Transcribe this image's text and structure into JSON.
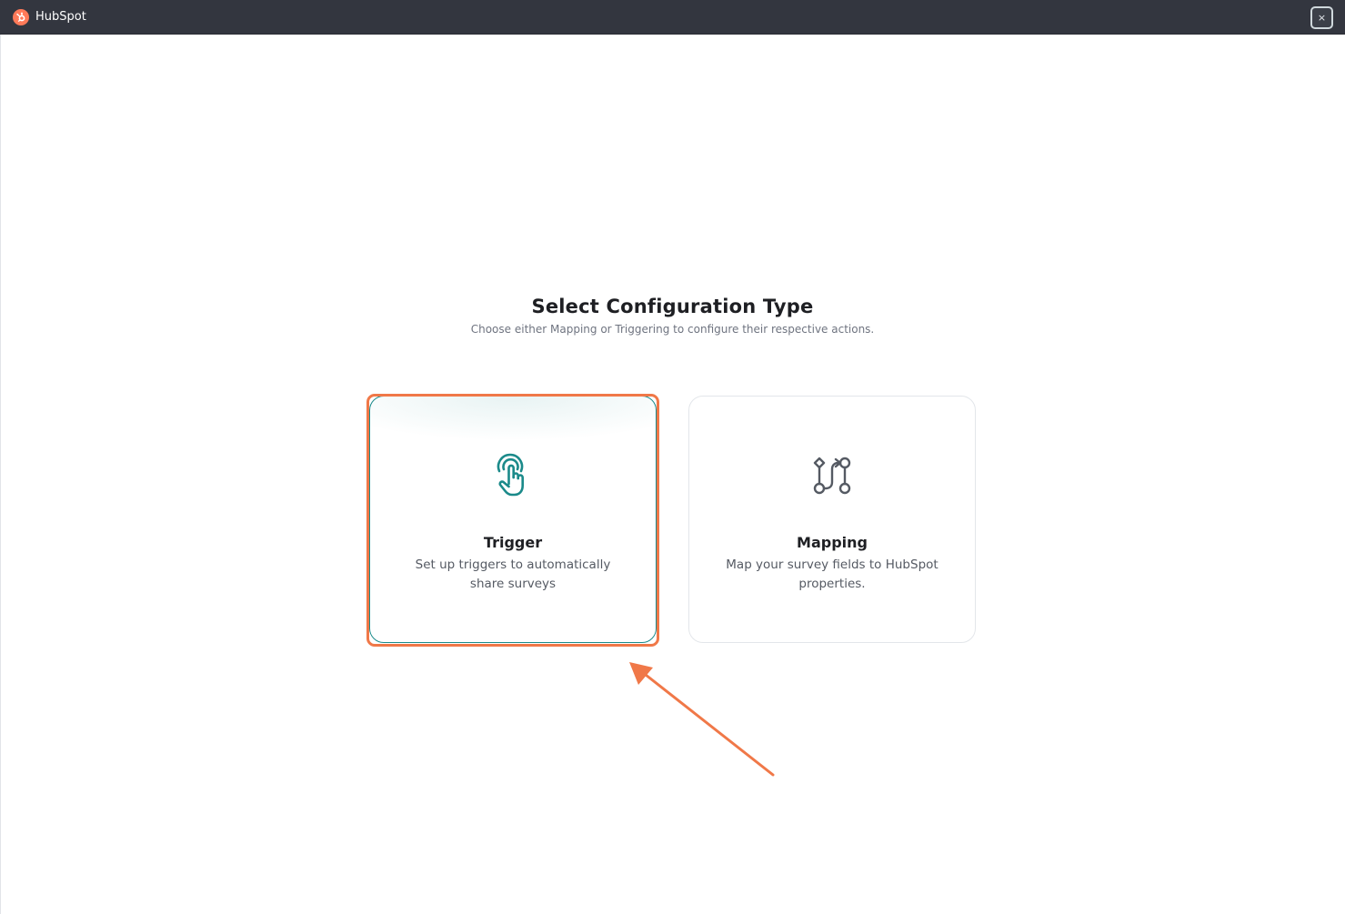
{
  "window": {
    "app_title": "HubSpot",
    "close_label": "×"
  },
  "page": {
    "title": "Select Configuration Type",
    "subtitle": "Choose either Mapping or Triggering to configure their respective actions."
  },
  "cards": [
    {
      "title": "Trigger",
      "description": "Set up triggers to automatically share surveys",
      "icon": "tap-finger-icon",
      "selected": true,
      "accent_color": "#1b8a8a"
    },
    {
      "title": "Mapping",
      "description": "Map your survey fields to HubSpot properties.",
      "icon": "mapping-nodes-icon",
      "selected": false
    }
  ],
  "colors": {
    "titlebar": "#33363f",
    "brand_orange": "#ff7a59",
    "annotation": "#f07848"
  }
}
